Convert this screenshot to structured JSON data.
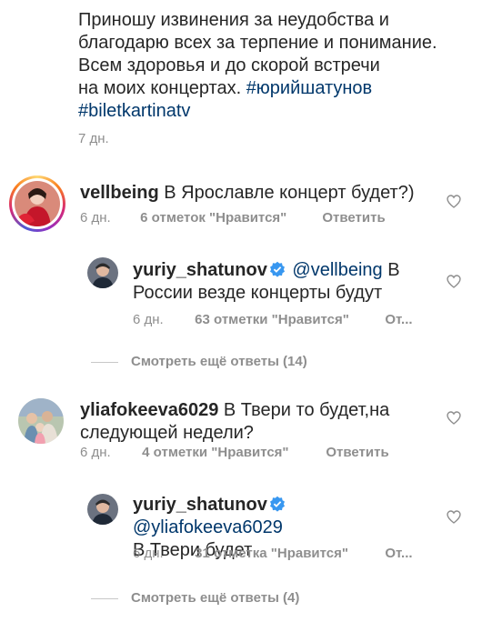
{
  "caption": {
    "line1": "Приношу извинения за неудобства и",
    "line2": "благодарю всех за терпение и понимание.",
    "line3": "Всем здоровья и до скорой встречи",
    "line4_text": "на моих концертах.",
    "line4_tag": "#юрийшатунов",
    "line5_tag": "#biletkartinatv",
    "time": "7 дн."
  },
  "comments": [
    {
      "username": "vellbeing",
      "text": "В Ярославле концерт будет?)",
      "time": "6 дн.",
      "likes": "6 отметок \"Нравится\"",
      "reply": "Ответить",
      "avatar": "woman-red-dress-avatar",
      "has_story_ring": true
    },
    {
      "username": "yuriy_shatunov",
      "verified": true,
      "mention": "@vellbeing",
      "text_inline": "В",
      "text_line2": "России везде концерты будут",
      "time": "6 дн.",
      "likes": "63 отметки \"Нравится\"",
      "reply": "От...",
      "avatar": "man-portrait-avatar"
    },
    {
      "view_replies": "Смотреть ещё ответы (14)"
    },
    {
      "username": "yliafokeeva6029",
      "text_inline": "В Твери то будет,на",
      "text_line2": "следующей недели?",
      "time": "6 дн.",
      "likes": "4 отметки \"Нравится\"",
      "reply": "Ответить",
      "avatar": "family-group-avatar"
    },
    {
      "username": "yuriy_shatunov",
      "verified": true,
      "mention": "@yliafokeeva6029",
      "text_line2": "В Твери будет",
      "time": "6 дн.",
      "likes": "31 отметка \"Нравится\"",
      "reply": "От...",
      "avatar": "man-portrait-avatar"
    },
    {
      "view_replies": "Смотреть ещё ответы (4)"
    }
  ],
  "colors": {
    "text": "#262626",
    "meta": "#8e8e8e",
    "link": "#00376b",
    "verified": "#3897f0"
  }
}
